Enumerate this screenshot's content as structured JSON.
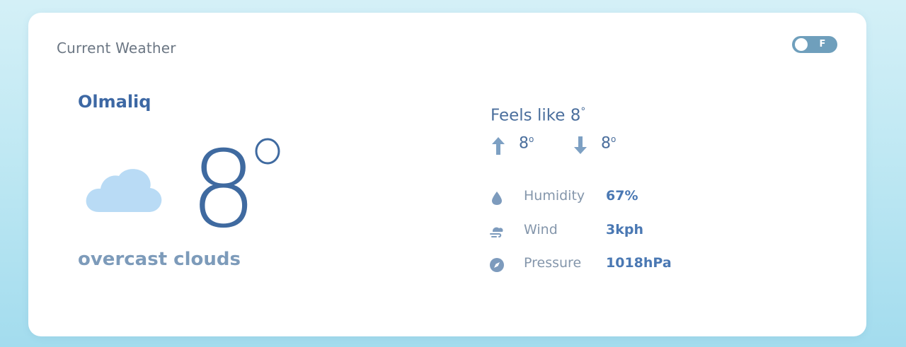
{
  "card": {
    "title": "Current Weather",
    "unit_toggle": {
      "label": "F",
      "state": "off"
    }
  },
  "current": {
    "city": "Olmaliq",
    "temperature": "8",
    "description": "overcast clouds",
    "condition_icon": "cloud-icon"
  },
  "details": {
    "feels_like_label": "Feels like 8",
    "feels_like_degree": "°",
    "max_temp": "8",
    "min_temp": "8",
    "degree_symbol": "o",
    "rows": [
      {
        "icon": "droplet-icon",
        "label": "Humidity",
        "value": "67%"
      },
      {
        "icon": "wind-icon",
        "label": "Wind",
        "value": "3kph"
      },
      {
        "icon": "compass-icon",
        "label": "Pressure",
        "value": "1018hPa"
      }
    ]
  },
  "colors": {
    "accent": "#3d68a4",
    "cloud": "#b9dbf5",
    "toggle": "#6f9fbc",
    "muted_text": "#8496ab"
  }
}
